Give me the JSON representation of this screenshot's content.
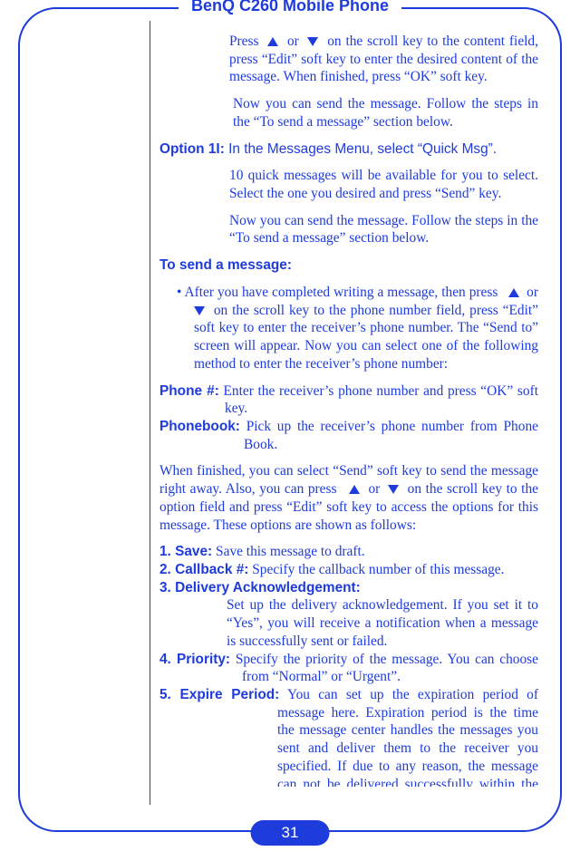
{
  "title": "BenQ C260 Mobile Phone",
  "page_number": "31",
  "intro_block": {
    "p1": "Press   ▲   or   ▼   on the scroll key to the content field, press “Edit” soft key to enter the desired content of the message. When finished, press “OK” soft key.",
    "p2": "Now you can send the message. Follow the steps in the “To send a message” section below."
  },
  "option1I": {
    "label": "Option 1I:",
    "line1": "In the Messages Menu, select “Quick Msg”.",
    "line2": "10 quick messages will be available for you to select. Select the one you desired and press “Send” key.",
    "line3": "Now you can send the message. Follow the steps in the “To send a message” section below."
  },
  "to_send_heading": "To send a message:",
  "bullet_after": "• After you have completed writing a message, then press    ▲  or ▼  on the scroll key to the phone number field, press “Edit” soft key to enter the receiver’s phone number. The “Send to” screen will appear. Now you can select one of the following method to enter the receiver’s phone number:",
  "phone_num": {
    "label": "Phone #:",
    "text": "Enter the receiver’s phone number and press “OK” soft key."
  },
  "phonebook": {
    "label": "Phonebook:",
    "text": "Pick up the receiver’s phone number from Phone Book."
  },
  "when_finished": "When finished, you can select “Send” soft key to send the message right away. Also, you can press    ▲  or  ▼  on the scroll key to the option field and press “Edit” soft key to access the options for this message. These options are shown as follows:",
  "opts": {
    "o1": {
      "label": "1. Save:",
      "text": "Save this message to draft."
    },
    "o2": {
      "label": "2. Callback #:",
      "text": "Specify the callback number of this message."
    },
    "o3": {
      "label": "3. Delivery Acknowledgement:",
      "text": "Set up the delivery acknowledgement. If you set it to “Yes”, you will receive a notification when a message is successfully sent or failed."
    },
    "o4": {
      "label": "4. Priority:",
      "text": "Specify the priority of the message. You can choose from “Normal” or “Urgent”."
    },
    "o5": {
      "label": "5. Expire Period:",
      "text": "You can set up the expiration period of message here. Expiration period is the time the message center handles the messages you sent and deliver them to the receiver you specified. If due to any reason, the message can not be delivered successfully within the expiration period, the"
    }
  }
}
